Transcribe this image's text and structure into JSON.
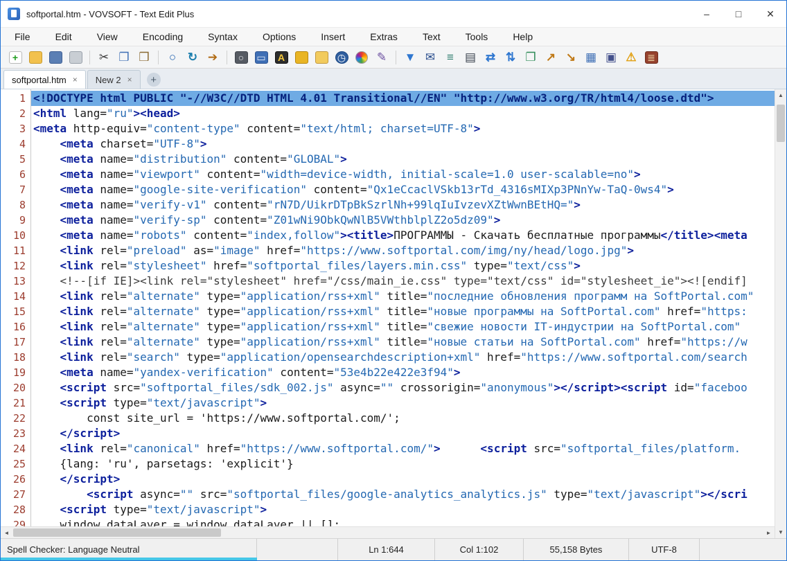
{
  "window": {
    "title": "softportal.htm - VOVSOFT - Text Edit Plus",
    "controls": {
      "minimize": "–",
      "maximize": "□",
      "close": "✕"
    }
  },
  "menu": {
    "items": [
      "File",
      "Edit",
      "View",
      "Encoding",
      "Syntax",
      "Options",
      "Insert",
      "Extras",
      "Text",
      "Tools",
      "Help"
    ]
  },
  "toolbar": {
    "icons": [
      {
        "name": "new-file-icon",
        "glyph": "+",
        "fg": "#1f9d1f",
        "bg": "#ffffff",
        "br": "#b9b9b9",
        "bold": true
      },
      {
        "name": "open-folder-icon",
        "glyph": "",
        "bg": "#f2c14e",
        "br": "#c89a2a"
      },
      {
        "name": "save-icon",
        "glyph": "",
        "bg": "#5b7fb4",
        "br": "#3d5e94"
      },
      {
        "name": "print-icon",
        "glyph": "",
        "bg": "#c9ced4",
        "br": "#98a0aa"
      },
      {
        "sep": true
      },
      {
        "name": "cut-icon",
        "glyph": "✂",
        "fg": "#3a3a3a"
      },
      {
        "name": "copy-icon",
        "glyph": "❐",
        "fg": "#3f6fb5"
      },
      {
        "name": "paste-icon",
        "glyph": "❒",
        "fg": "#8a6a32"
      },
      {
        "sep": true
      },
      {
        "name": "find-icon",
        "glyph": "○",
        "fg": "#1d5fae",
        "bold": true
      },
      {
        "name": "replace-icon",
        "glyph": "↻",
        "fg": "#1d7fae",
        "bold": true
      },
      {
        "name": "goto-icon",
        "glyph": "➔",
        "fg": "#b06a12"
      },
      {
        "sep": true
      },
      {
        "name": "zoom-view-icon",
        "glyph": "○",
        "fg": "#e8eaee",
        "bg": "#565b63",
        "br": "#3e434b"
      },
      {
        "name": "display-icon",
        "glyph": "▭",
        "fg": "#eaf1fb",
        "bg": "#3f6fb5",
        "br": "#2d5492"
      },
      {
        "name": "font-icon",
        "glyph": "A",
        "fg": "#f3c73d",
        "bg": "#2d2d2d",
        "br": "#111111",
        "bold": true
      },
      {
        "name": "lock-icon",
        "glyph": "",
        "bg": "#e9b525",
        "br": "#b9880e"
      },
      {
        "name": "unlock-icon",
        "glyph": "",
        "bg": "#f2cb5e",
        "br": "#c2983e"
      },
      {
        "name": "clock-icon",
        "glyph": "◷",
        "fg": "#ffffff",
        "bg": "#2f5e9e",
        "br": "#1d4884",
        "round": true
      },
      {
        "name": "color-picker-icon",
        "wheel": true
      },
      {
        "name": "pen-icon",
        "glyph": "✎",
        "fg": "#6b4fa0"
      },
      {
        "sep": true
      },
      {
        "name": "filter-icon",
        "glyph": "▼",
        "fg": "#2f77d0"
      },
      {
        "name": "email-icon",
        "glyph": "✉",
        "fg": "#2b4f8e"
      },
      {
        "name": "numbered-list-icon",
        "glyph": "≡",
        "fg": "#2e7d6e",
        "bold": true
      },
      {
        "name": "print-preview-icon",
        "glyph": "▤",
        "fg": "#3c4450"
      },
      {
        "name": "swap-horizontal-icon",
        "glyph": "⇄",
        "fg": "#2f77d0",
        "bold": true
      },
      {
        "name": "swap-vertical-icon",
        "glyph": "⇅",
        "fg": "#2f77d0",
        "bold": true
      },
      {
        "name": "duplicate-icon",
        "glyph": "❐",
        "fg": "#2e8b57"
      },
      {
        "name": "export-icon",
        "glyph": "↗",
        "fg": "#c07a18",
        "bold": true
      },
      {
        "name": "import-icon",
        "glyph": "↘",
        "fg": "#c07a18",
        "bold": true
      },
      {
        "name": "table-icon",
        "glyph": "▦",
        "fg": "#3f6fb5"
      },
      {
        "name": "save-all-icon",
        "glyph": "▣",
        "fg": "#44518c"
      },
      {
        "name": "warning-icon",
        "glyph": "⚠",
        "fg": "#e2a012",
        "bold": true
      },
      {
        "name": "calculator-icon",
        "glyph": "≣",
        "fg": "#f7e3b0",
        "bg": "#96422e",
        "br": "#6f2d1d"
      }
    ]
  },
  "tabs": {
    "close_glyph": "×",
    "add_glyph": "+",
    "items": [
      {
        "label": "softportal.htm",
        "active": true
      },
      {
        "label": "New 2",
        "active": false
      }
    ]
  },
  "editor": {
    "lines": [
      {
        "num": 1,
        "selected": true,
        "tokens": [
          [
            "g",
            "<!DOCTYPE html PUBLIC "
          ],
          [
            "s",
            "\"-//W3C//DTD HTML 4.01 Transitional//EN\" \"http://www.w3.org/TR/html4/loose.dtd\""
          ],
          [
            "g",
            ">"
          ]
        ]
      },
      {
        "num": 2,
        "tokens": [
          [
            "g",
            "<html "
          ],
          [
            "a",
            "lang="
          ],
          [
            "s",
            "\"ru\""
          ],
          [
            "g",
            "><head>"
          ]
        ]
      },
      {
        "num": 3,
        "tokens": [
          [
            "g",
            "<meta "
          ],
          [
            "a",
            "http-equiv="
          ],
          [
            "s",
            "\"content-type\""
          ],
          [
            "a",
            " content="
          ],
          [
            "s",
            "\"text/html; charset=UTF-8\""
          ],
          [
            "g",
            ">"
          ]
        ]
      },
      {
        "num": 4,
        "tokens": [
          [
            "t",
            "    "
          ],
          [
            "g",
            "<meta "
          ],
          [
            "a",
            "charset="
          ],
          [
            "s",
            "\"UTF-8\""
          ],
          [
            "g",
            ">"
          ]
        ]
      },
      {
        "num": 5,
        "tokens": [
          [
            "t",
            "    "
          ],
          [
            "g",
            "<meta "
          ],
          [
            "a",
            "name="
          ],
          [
            "s",
            "\"distribution\""
          ],
          [
            "a",
            " content="
          ],
          [
            "s",
            "\"GLOBAL\""
          ],
          [
            "g",
            ">"
          ]
        ]
      },
      {
        "num": 6,
        "tokens": [
          [
            "t",
            "    "
          ],
          [
            "g",
            "<meta "
          ],
          [
            "a",
            "name="
          ],
          [
            "s",
            "\"viewport\""
          ],
          [
            "a",
            " content="
          ],
          [
            "s",
            "\"width=device-width, initial-scale=1.0 user-scalable=no\""
          ],
          [
            "g",
            ">"
          ]
        ]
      },
      {
        "num": 7,
        "tokens": [
          [
            "t",
            "    "
          ],
          [
            "g",
            "<meta "
          ],
          [
            "a",
            "name="
          ],
          [
            "s",
            "\"google-site-verification\""
          ],
          [
            "a",
            " content="
          ],
          [
            "s",
            "\"Qx1eCcaclVSkb13rTd_4316sMIXp3PNnYw-TaQ-0ws4\""
          ],
          [
            "g",
            ">"
          ]
        ]
      },
      {
        "num": 8,
        "tokens": [
          [
            "t",
            "    "
          ],
          [
            "g",
            "<meta "
          ],
          [
            "a",
            "name="
          ],
          [
            "s",
            "\"verify-v1\""
          ],
          [
            "a",
            " content="
          ],
          [
            "s",
            "\"rN7D/UikrDTpBkSzrlNh+99lqIuIvzevXZtWwnBEtHQ=\""
          ],
          [
            "g",
            ">"
          ]
        ]
      },
      {
        "num": 9,
        "tokens": [
          [
            "t",
            "    "
          ],
          [
            "g",
            "<meta "
          ],
          [
            "a",
            "name="
          ],
          [
            "s",
            "\"verify-sp\""
          ],
          [
            "a",
            " content="
          ],
          [
            "s",
            "\"Z01wNi9ObkQwNlB5VWthblplZ2o5dz09\""
          ],
          [
            "g",
            ">"
          ]
        ]
      },
      {
        "num": 10,
        "tokens": [
          [
            "t",
            "    "
          ],
          [
            "g",
            "<meta "
          ],
          [
            "a",
            "name="
          ],
          [
            "s",
            "\"robots\""
          ],
          [
            "a",
            " content="
          ],
          [
            "s",
            "\"index,follow\""
          ],
          [
            "g",
            "><title>"
          ],
          [
            "t",
            "ПРОГРАММЫ - Скачать бесплатные программы"
          ],
          [
            "g",
            "</title><meta"
          ]
        ]
      },
      {
        "num": 11,
        "tokens": [
          [
            "t",
            "    "
          ],
          [
            "g",
            "<link "
          ],
          [
            "a",
            "rel="
          ],
          [
            "s",
            "\"preload\""
          ],
          [
            "a",
            " as="
          ],
          [
            "s",
            "\"image\""
          ],
          [
            "a",
            " href="
          ],
          [
            "s",
            "\"https://www.softportal.com/img/ny/head/logo.jpg\""
          ],
          [
            "g",
            ">"
          ]
        ]
      },
      {
        "num": 12,
        "tokens": [
          [
            "t",
            "    "
          ],
          [
            "g",
            "<link "
          ],
          [
            "a",
            "rel="
          ],
          [
            "s",
            "\"stylesheet\""
          ],
          [
            "a",
            " href="
          ],
          [
            "s",
            "\"softportal_files/layers.min.css\""
          ],
          [
            "a",
            " type="
          ],
          [
            "s",
            "\"text/css\""
          ],
          [
            "g",
            ">"
          ]
        ]
      },
      {
        "num": 13,
        "tokens": [
          [
            "t",
            "    "
          ],
          [
            "c",
            "<!--[if IE]><link rel=\"stylesheet\" href=\"/css/main_ie.css\" type=\"text/css\" id=\"stylesheet_ie\"><![endif]"
          ]
        ]
      },
      {
        "num": 14,
        "tokens": [
          [
            "t",
            "    "
          ],
          [
            "g",
            "<link "
          ],
          [
            "a",
            "rel="
          ],
          [
            "s",
            "\"alternate\""
          ],
          [
            "a",
            " type="
          ],
          [
            "s",
            "\"application/rss+xml\""
          ],
          [
            "a",
            " title="
          ],
          [
            "s",
            "\"последние обновления программ на SoftPortal.com\""
          ]
        ]
      },
      {
        "num": 15,
        "tokens": [
          [
            "t",
            "    "
          ],
          [
            "g",
            "<link "
          ],
          [
            "a",
            "rel="
          ],
          [
            "s",
            "\"alternate\""
          ],
          [
            "a",
            " type="
          ],
          [
            "s",
            "\"application/rss+xml\""
          ],
          [
            "a",
            " title="
          ],
          [
            "s",
            "\"новые программы на SoftPortal.com\""
          ],
          [
            "a",
            " href="
          ],
          [
            "s",
            "\"https:"
          ]
        ]
      },
      {
        "num": 16,
        "tokens": [
          [
            "t",
            "    "
          ],
          [
            "g",
            "<link "
          ],
          [
            "a",
            "rel="
          ],
          [
            "s",
            "\"alternate\""
          ],
          [
            "a",
            " type="
          ],
          [
            "s",
            "\"application/rss+xml\""
          ],
          [
            "a",
            " title="
          ],
          [
            "s",
            "\"свежие новости IT-индустрии на SoftPortal.com\""
          ]
        ]
      },
      {
        "num": 17,
        "tokens": [
          [
            "t",
            "    "
          ],
          [
            "g",
            "<link "
          ],
          [
            "a",
            "rel="
          ],
          [
            "s",
            "\"alternate\""
          ],
          [
            "a",
            " type="
          ],
          [
            "s",
            "\"application/rss+xml\""
          ],
          [
            "a",
            " title="
          ],
          [
            "s",
            "\"новые статьи на SoftPortal.com\""
          ],
          [
            "a",
            " href="
          ],
          [
            "s",
            "\"https://w"
          ]
        ]
      },
      {
        "num": 18,
        "tokens": [
          [
            "t",
            "    "
          ],
          [
            "g",
            "<link "
          ],
          [
            "a",
            "rel="
          ],
          [
            "s",
            "\"search\""
          ],
          [
            "a",
            " type="
          ],
          [
            "s",
            "\"application/opensearchdescription+xml\""
          ],
          [
            "a",
            " href="
          ],
          [
            "s",
            "\"https://www.softportal.com/search"
          ]
        ]
      },
      {
        "num": 19,
        "tokens": [
          [
            "t",
            "    "
          ],
          [
            "g",
            "<meta "
          ],
          [
            "a",
            "name="
          ],
          [
            "s",
            "\"yandex-verification\""
          ],
          [
            "a",
            " content="
          ],
          [
            "s",
            "\"53e4b22e422e3f94\""
          ],
          [
            "g",
            ">"
          ]
        ]
      },
      {
        "num": 20,
        "tokens": [
          [
            "t",
            "    "
          ],
          [
            "g",
            "<script "
          ],
          [
            "a",
            "src="
          ],
          [
            "s",
            "\"softportal_files/sdk_002.js\""
          ],
          [
            "a",
            " async="
          ],
          [
            "s",
            "\"\""
          ],
          [
            "a",
            " crossorigin="
          ],
          [
            "s",
            "\"anonymous\""
          ],
          [
            "g",
            "></script><script "
          ],
          [
            "a",
            "id="
          ],
          [
            "s",
            "\"faceboo"
          ]
        ]
      },
      {
        "num": 21,
        "tokens": [
          [
            "t",
            "    "
          ],
          [
            "g",
            "<script "
          ],
          [
            "a",
            "type="
          ],
          [
            "s",
            "\"text/javascript\""
          ],
          [
            "g",
            ">"
          ]
        ]
      },
      {
        "num": 22,
        "tokens": [
          [
            "t",
            "        const site_url = 'https://www.softportal.com/';"
          ]
        ]
      },
      {
        "num": 23,
        "tokens": [
          [
            "t",
            "    "
          ],
          [
            "g",
            "</script>"
          ]
        ]
      },
      {
        "num": 24,
        "tokens": [
          [
            "t",
            "    "
          ],
          [
            "g",
            "<link "
          ],
          [
            "a",
            "rel="
          ],
          [
            "s",
            "\"canonical\""
          ],
          [
            "a",
            " href="
          ],
          [
            "s",
            "\"https://www.softportal.com/\""
          ],
          [
            "g",
            ">"
          ],
          [
            "t",
            "      "
          ],
          [
            "g",
            "<script "
          ],
          [
            "a",
            "src="
          ],
          [
            "s",
            "\"softportal_files/platform."
          ]
        ]
      },
      {
        "num": 25,
        "tokens": [
          [
            "t",
            "    {lang: 'ru', parsetags: 'explicit'}"
          ]
        ]
      },
      {
        "num": 26,
        "tokens": [
          [
            "t",
            "    "
          ],
          [
            "g",
            "</script>"
          ]
        ]
      },
      {
        "num": 27,
        "tokens": [
          [
            "t",
            "        "
          ],
          [
            "g",
            "<script "
          ],
          [
            "a",
            "async="
          ],
          [
            "s",
            "\"\""
          ],
          [
            "a",
            " src="
          ],
          [
            "s",
            "\"softportal_files/google-analytics_analytics.js\""
          ],
          [
            "a",
            " type="
          ],
          [
            "s",
            "\"text/javascript\""
          ],
          [
            "g",
            "></scri"
          ]
        ]
      },
      {
        "num": 28,
        "tokens": [
          [
            "t",
            "    "
          ],
          [
            "g",
            "<script "
          ],
          [
            "a",
            "type="
          ],
          [
            "s",
            "\"text/javascript\""
          ],
          [
            "g",
            ">"
          ]
        ]
      },
      {
        "num": 29,
        "tokens": [
          [
            "t",
            "    window.dataLayer = window.dataLayer || [];"
          ]
        ]
      }
    ]
  },
  "scrollbars": {
    "up": "▲",
    "down": "▼",
    "left": "◄",
    "right": "►"
  },
  "statusbar": {
    "spell": "Spell Checker: Language Neutral",
    "line": "Ln 1:644",
    "column": "Col 1:102",
    "size": "55,158 Bytes",
    "encoding": "UTF-8"
  },
  "colors": {
    "selection": "#6fabe4",
    "tag": "#0c1f9c",
    "string": "#2468b2",
    "line_number": "#9c3c2e",
    "accent": "#2574d4",
    "progress": "#45c7e8"
  }
}
